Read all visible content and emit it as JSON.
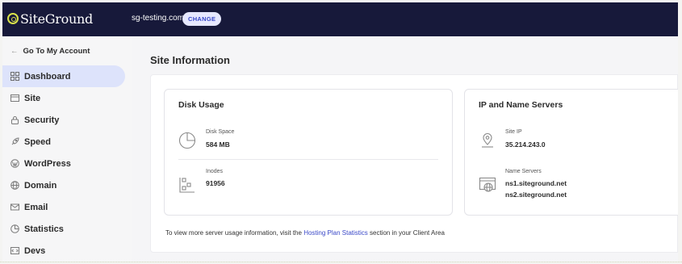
{
  "brand": {
    "name": "SiteGround"
  },
  "header": {
    "site_name": "sg-testing.com",
    "change_label": "CHANGE"
  },
  "sidebar": {
    "back_label": "Go To My Account",
    "items": [
      {
        "label": "Dashboard",
        "icon": "dashboard-icon",
        "active": true
      },
      {
        "label": "Site",
        "icon": "site-icon"
      },
      {
        "label": "Security",
        "icon": "lock-icon"
      },
      {
        "label": "Speed",
        "icon": "rocket-icon"
      },
      {
        "label": "WordPress",
        "icon": "wordpress-icon"
      },
      {
        "label": "Domain",
        "icon": "globe-icon"
      },
      {
        "label": "Email",
        "icon": "envelope-icon"
      },
      {
        "label": "Statistics",
        "icon": "chart-icon"
      },
      {
        "label": "Devs",
        "icon": "code-icon"
      }
    ]
  },
  "main": {
    "title": "Site Information",
    "disk_usage": {
      "title": "Disk Usage",
      "disk_space_label": "Disk Space",
      "disk_space_value": "584 MB",
      "inodes_label": "Inodes",
      "inodes_value": "91956"
    },
    "ip_servers": {
      "title": "IP and Name Servers",
      "site_ip_label": "Site IP",
      "site_ip_value": "35.214.243.0",
      "name_servers_label": "Name Servers",
      "name_servers": [
        "ns1.siteground.net",
        "ns2.siteground.net"
      ]
    },
    "footer": {
      "prefix": "To view more server usage information, visit the ",
      "link": "Hosting Plan Statistics",
      "suffix": " section in your Client Area"
    }
  },
  "colors": {
    "topbar": "#17193a",
    "accent": "#3b49c8",
    "active_nav": "#dde3fb",
    "logo_accent": "#d9e34a"
  }
}
